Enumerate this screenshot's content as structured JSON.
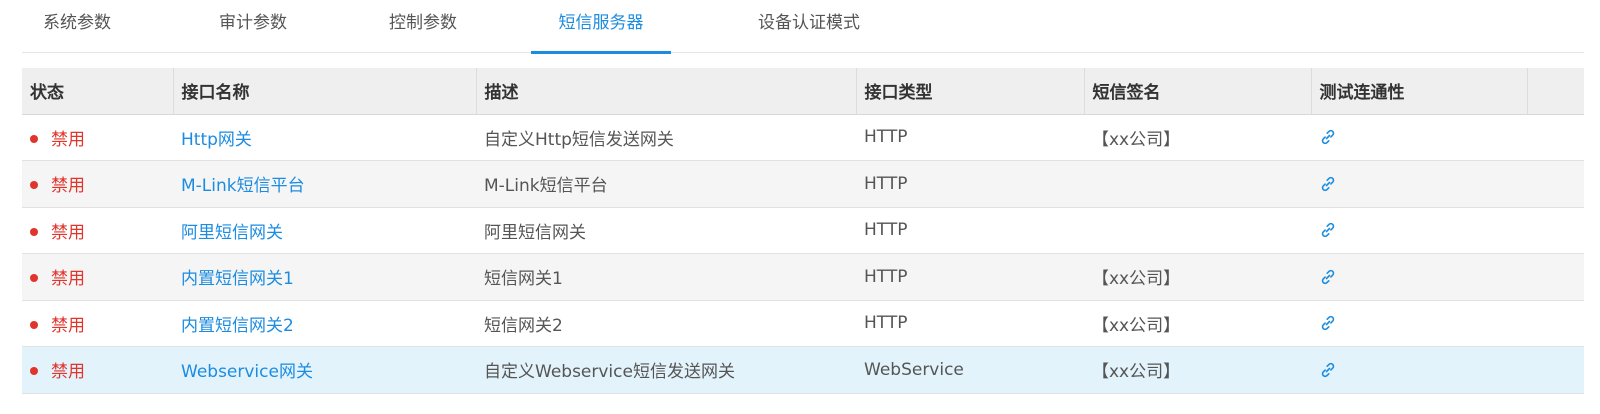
{
  "tabs": [
    {
      "label": "系统参数",
      "active": false
    },
    {
      "label": "审计参数",
      "active": false
    },
    {
      "label": "控制参数",
      "active": false
    },
    {
      "label": "短信服务器",
      "active": true
    },
    {
      "label": "设备认证模式",
      "active": false
    }
  ],
  "table": {
    "columns": [
      "状态",
      "接口名称",
      "描述",
      "接口类型",
      "短信签名",
      "测试连通性"
    ],
    "rows": [
      {
        "status": "禁用",
        "name": "Http网关",
        "desc": "自定义Http短信发送网关",
        "type": "HTTP",
        "signature": "【xx公司】",
        "test_icon": "link-icon"
      },
      {
        "status": "禁用",
        "name": "M-Link短信平台",
        "desc": "M-Link短信平台",
        "type": "HTTP",
        "signature": "",
        "test_icon": "link-icon"
      },
      {
        "status": "禁用",
        "name": "阿里短信网关",
        "desc": "阿里短信网关",
        "type": "HTTP",
        "signature": "",
        "test_icon": "link-icon"
      },
      {
        "status": "禁用",
        "name": "内置短信网关1",
        "desc": "短信网关1",
        "type": "HTTP",
        "signature": "【xx公司】",
        "test_icon": "link-icon"
      },
      {
        "status": "禁用",
        "name": "内置短信网关2",
        "desc": "短信网关2",
        "type": "HTTP",
        "signature": "【xx公司】",
        "test_icon": "link-icon"
      },
      {
        "status": "禁用",
        "name": "Webservice网关",
        "desc": "自定义Webservice短信发送网关",
        "type": "WebService",
        "signature": "【xx公司】",
        "test_icon": "link-icon"
      }
    ],
    "selected_row": 5
  },
  "colors": {
    "accent": "#1c8ce0",
    "disabled": "#e0342c",
    "header_bg": "#efefef",
    "alt_row_bg": "#f5f5f5",
    "selected_row_bg": "#e3f3fb"
  }
}
